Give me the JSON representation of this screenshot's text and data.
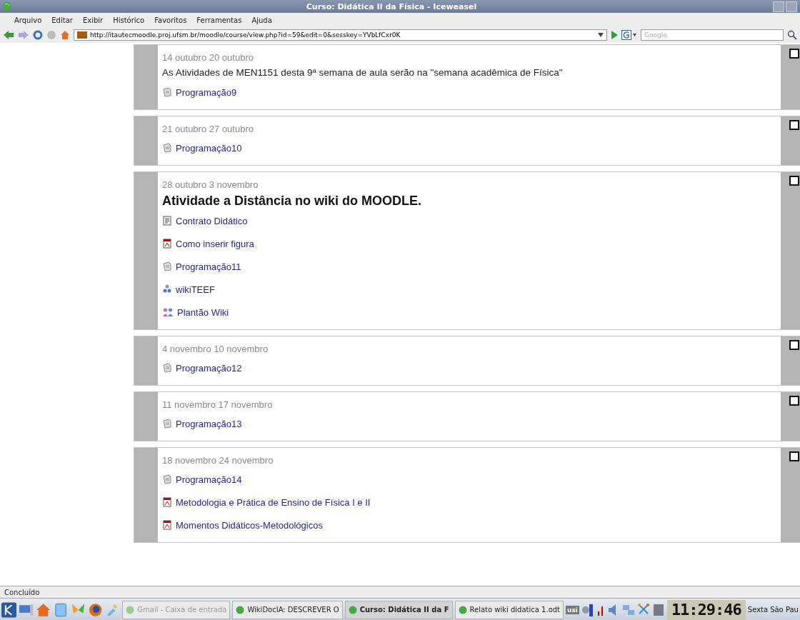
{
  "window": {
    "title": "Curso: Didática II da Física - Iceweasel"
  },
  "menu": [
    {
      "label": "Arquivo"
    },
    {
      "label": "Editar"
    },
    {
      "label": "Exibir"
    },
    {
      "label": "Histórico"
    },
    {
      "label": "Favoritos"
    },
    {
      "label": "Ferramentas"
    },
    {
      "label": "Ajuda"
    }
  ],
  "address_bar": {
    "value": "http://itautecmoodle.proj.ufsm.br/moodle/course/view.php?id=59&edit=0&sesskey=YVbLfCxr0K"
  },
  "search": {
    "placeholder": "Google"
  },
  "weeks": [
    {
      "dates": "14 outubro 20 outubro",
      "summary": {
        "kind": "plain",
        "text": "As Atividades de MEN1151 desta 9ª semana de aula serão na \"semana acadêmica de Física\""
      },
      "items": [
        {
          "kind": "page",
          "label": "Programação9"
        }
      ]
    },
    {
      "dates": "21 outubro 27 outubro",
      "items": [
        {
          "kind": "page",
          "label": "Programação10"
        }
      ]
    },
    {
      "dates": "28 outubro 3 novembro",
      "summary": {
        "kind": "heading",
        "text": "Atividade a Distância no wiki do MOODLE."
      },
      "items": [
        {
          "kind": "text",
          "label": "Contrato Didático"
        },
        {
          "kind": "pdf",
          "label": "Como inserir figura"
        },
        {
          "kind": "page",
          "label": "Programação11"
        },
        {
          "kind": "wiki",
          "label": "wikiTEEF"
        },
        {
          "kind": "chat",
          "label": "Plantão Wiki"
        }
      ]
    },
    {
      "dates": "4 novembro 10 novembro",
      "items": [
        {
          "kind": "page",
          "label": "Programação12"
        }
      ]
    },
    {
      "dates": "11 novembro 17 novembro",
      "items": [
        {
          "kind": "page",
          "label": "Programação13"
        }
      ]
    },
    {
      "dates": "18 novembro 24 novembro",
      "items": [
        {
          "kind": "page",
          "label": "Programação14"
        },
        {
          "kind": "pdf",
          "label": "Metodologia e Prática de Ensino de Física I e II"
        },
        {
          "kind": "pdf",
          "label": "Momentos Didáticos-Metodológicos"
        }
      ]
    }
  ],
  "status_bar": {
    "text": "Concluído"
  },
  "taskbar": {
    "tasks": [
      {
        "label": "Gmail - Caixa de entrada",
        "selected": false,
        "minimized": true
      },
      {
        "label": "WikiDocIA: DESCREVER O",
        "selected": false,
        "minimized": false
      },
      {
        "label": "Curso: Didática II da F",
        "selected": true,
        "minimized": false
      },
      {
        "label": "Relato wiki didatica 1.odt",
        "selected": false,
        "minimized": false
      }
    ],
    "tray_label": "usi",
    "clock": "11:29:46",
    "day": "Sexta",
    "place": "São Pau"
  }
}
